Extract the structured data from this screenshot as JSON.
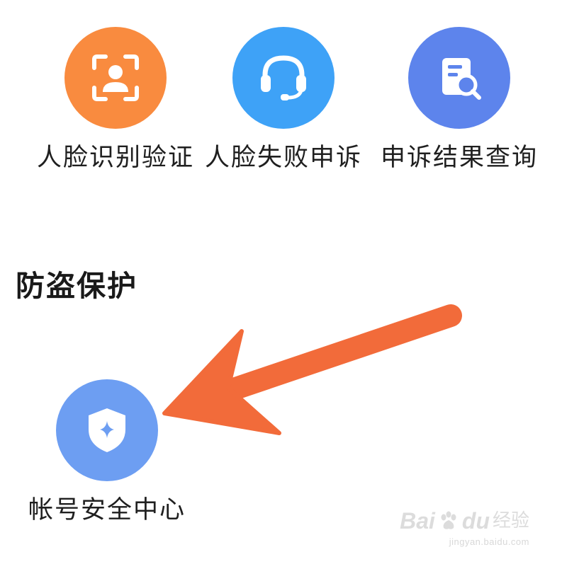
{
  "services": {
    "face_verify": {
      "label": "人脸识别验证",
      "icon": "face-scan-icon",
      "color": "#f98b3f"
    },
    "face_appeal": {
      "label": "人脸失败申诉",
      "icon": "headset-icon",
      "color": "#3ea2f7"
    },
    "appeal_result": {
      "label": "申诉结果查询",
      "icon": "document-search-icon",
      "color": "#5d84ec"
    }
  },
  "theft_protection": {
    "title": "防盗保护",
    "account_security": {
      "label": "帐号安全中心",
      "icon": "shield-star-icon",
      "color": "#6d9ef2"
    }
  },
  "annotation": {
    "arrow_color": "#f26b3a"
  },
  "watermark": {
    "brand": "Bai",
    "brand2": "du",
    "suffix": "经验",
    "url": "jingyan.baidu.com"
  }
}
